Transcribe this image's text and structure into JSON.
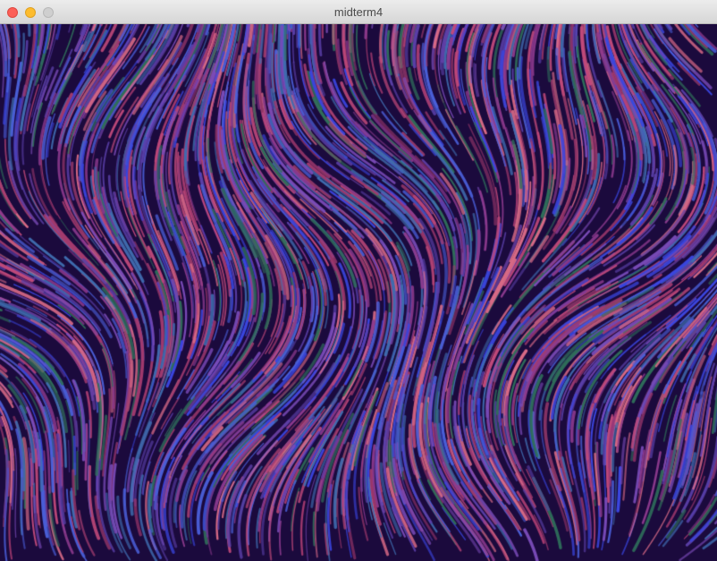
{
  "window": {
    "title": "midterm4"
  },
  "canvas": {
    "background": "#1b0a3d",
    "palette": [
      "#3a46e0",
      "#4a5fd8",
      "#3f6db0",
      "#a23a6e",
      "#c0497a",
      "#8d3a8e",
      "#7a4bb8",
      "#2f6e5a",
      "#d86a86",
      "#5a3fa8"
    ]
  }
}
